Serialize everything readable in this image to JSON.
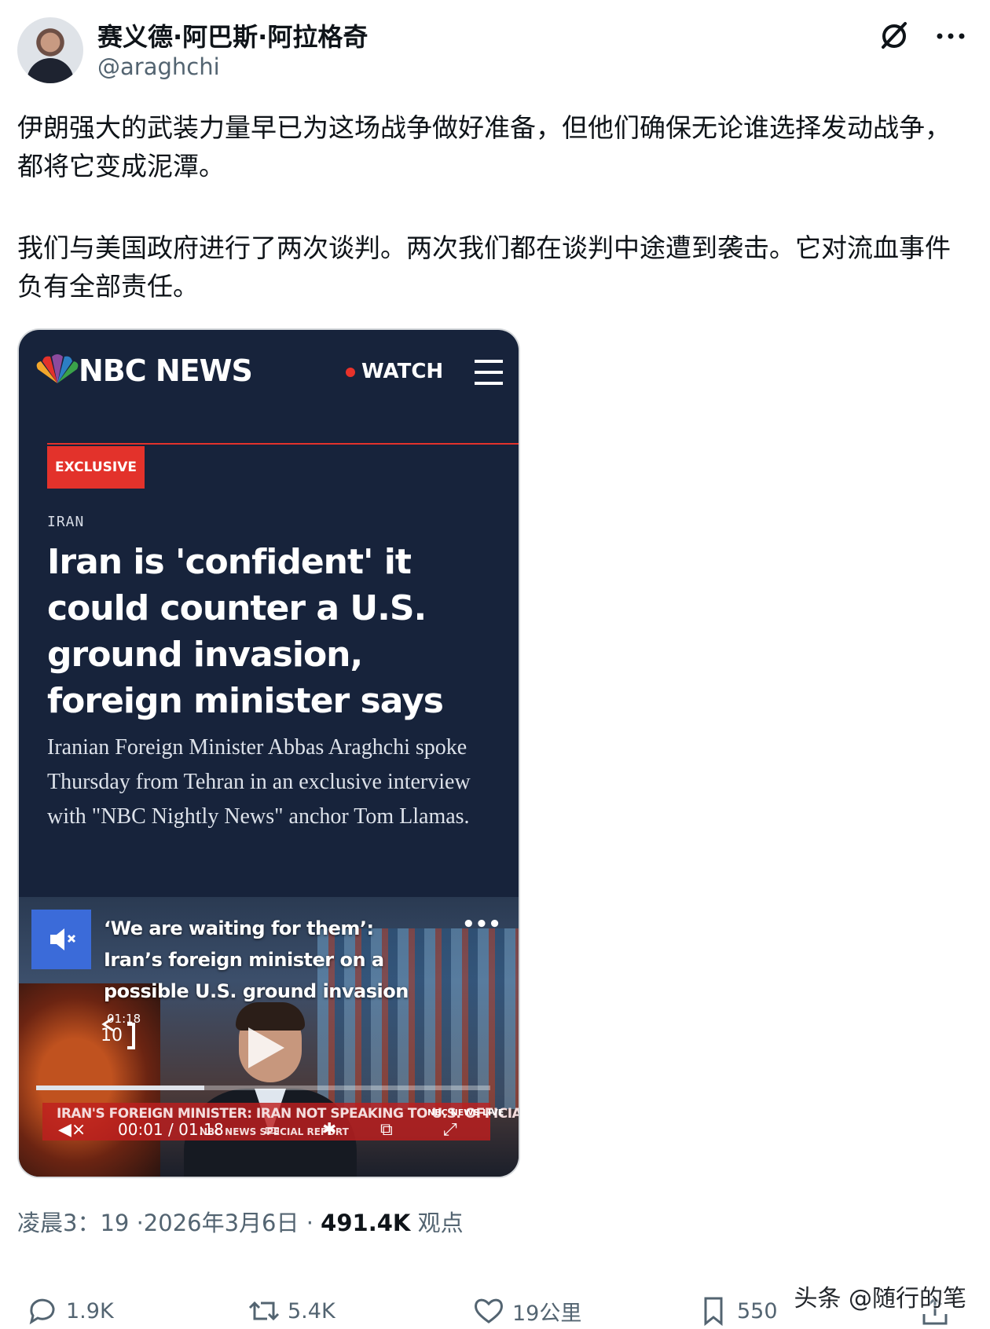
{
  "author": {
    "display_name": "赛义德·阿巴斯·阿拉格奇",
    "handle": "@araghchi"
  },
  "post": {
    "paragraphs": [
      "伊朗强大的武装力量早已为这场战争做好准备，但他们确保无论谁选择发动战争，都将它变成泥潭。",
      "我们与美国政府进行了两次谈判。两次我们都在谈判中途遭到袭击。它对流血事件负有全部责任。"
    ]
  },
  "embed": {
    "brand": "NBC NEWS",
    "watch_label": "WATCH",
    "badge": "EXCLUSIVE",
    "kicker": "IRAN",
    "headline": "Iran is 'confident' it could counter a U.S. ground invasion, foreign minister says",
    "dek": "Iranian Foreign Minister Abbas Araghchi spoke Thursday from Tehran in an exclusive interview with \"NBC Nightly News\" anchor Tom Llamas.",
    "video": {
      "title": "‘We are waiting for them’: Iran’s foreign minister on a possible U.S. ground invasion",
      "more": "•••",
      "rewind_time": "01:18",
      "rewind_seconds": "10",
      "progress": 0.37,
      "ticker": "IRAN'S FOREIGN MINISTER: IRAN NOT SPEAKING TO U.S. OFFICIALS",
      "ticker_sub": "NBC NEWS SPECIAL REPORT",
      "ticker_brand": "NBC NEWS LIVE",
      "current_time": "00:01",
      "duration": "01:18"
    }
  },
  "meta": {
    "time": "凌晨3：19",
    "date": "·2026年3月6日 ·",
    "views": "491.4K",
    "views_label": "观点"
  },
  "actions": {
    "replies": "1.9K",
    "reposts": "5.4K",
    "likes": "19公里",
    "bookmarks": "550"
  },
  "watermark": "头条 @随行的笔",
  "colors": {
    "nbc_navy": "#17233b",
    "nbc_red": "#e3322b",
    "mute_blue": "#3b6bd9",
    "secondary_text": "#536471"
  }
}
